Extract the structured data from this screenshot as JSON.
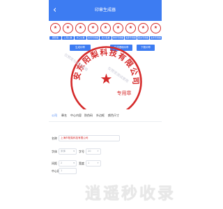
{
  "header": {
    "title": "印章生成器",
    "back_icon": "chevron-left-icon",
    "color": "#3d7cf2"
  },
  "templates": [
    {
      "label": "圆形章"
    },
    {
      "label": "上海公章"
    },
    {
      "label": "方口公章"
    },
    {
      "label": "合同专用章"
    },
    {
      "label": "法人私章"
    },
    {
      "label": "财务专用章"
    },
    {
      "label": "发票专用章"
    },
    {
      "label": "报关专用章"
    },
    {
      "label": "业务专用章"
    }
  ],
  "preview": {
    "buttons": {
      "generate": "生成印章",
      "download": "生成透明印章",
      "share": "下载印章"
    },
    "seal_ring_text": "安东阳梨科技有限公司",
    "seal_center_text": "专用章",
    "watermarks": [
      "仅预览与测试使用",
      "仅预览测试使用"
    ],
    "seal_color": "#d52a2a"
  },
  "settings": {
    "tabs": [
      "公司",
      "章名",
      "中心内容",
      "防伪码",
      "外边框",
      "颜色尺寸"
    ],
    "active_tab": 0,
    "company": {
      "label": "名称",
      "value": "上海市阳梨科技有限公司"
    },
    "font": {
      "label": "字体",
      "value": "宋体",
      "size_label": "字号",
      "size_value": "20"
    },
    "spacing": {
      "label": "间距",
      "value": "2",
      "extra_label": "宽度",
      "extra_value": "1"
    },
    "center": {
      "label": "中心形",
      "value": "1"
    }
  },
  "brand_mark": "逍遥秒收录"
}
